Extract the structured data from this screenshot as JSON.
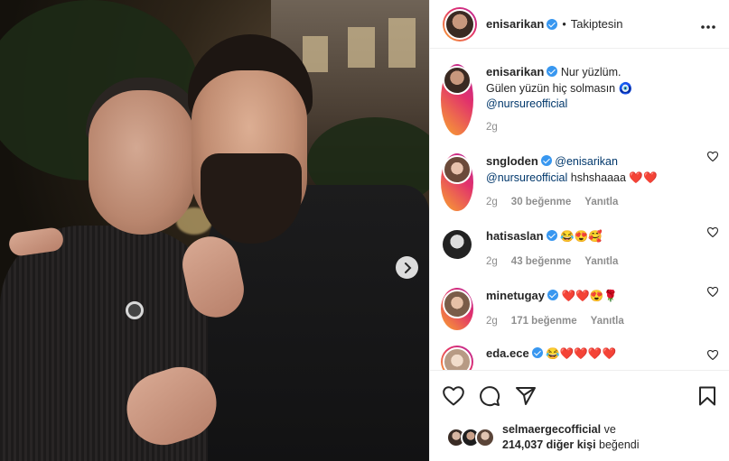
{
  "post": {
    "next_icon": "chevron-right-icon"
  },
  "header": {
    "username": "enisarikan",
    "separator": "•",
    "follow_status": "Takiptesin",
    "more_icon": "more-horizontal-icon"
  },
  "caption": {
    "username": "enisarikan",
    "text_line1": "Nur yüzlüm.",
    "text_line2": "Gülen yüzün hiç solmasın",
    "emoji": "🧿",
    "mention": "@nursureofficial",
    "time": "2g"
  },
  "comments": [
    {
      "username": "sngloden",
      "mention1": "@enisarikan",
      "mention2": "@nursureofficial",
      "text": "hshshaaaa",
      "emojis": "❤️❤️",
      "time": "2g",
      "likes": "30 beğenme",
      "reply": "Yanıtla"
    },
    {
      "username": "hatisaslan",
      "emojis": "😂😍🥰",
      "time": "2g",
      "likes": "43 beğenme",
      "reply": "Yanıtla"
    },
    {
      "username": "minetugay",
      "emojis": "❤️❤️😍🌹",
      "time": "2g",
      "likes": "171 beğenme",
      "reply": "Yanıtla"
    },
    {
      "username": "eda.ece",
      "emojis": "😂❤️❤️❤️❤️"
    }
  ],
  "likes_summary": {
    "top_liker": "selmaergecofficial",
    "connector": "ve",
    "others": "214,037 diğer kişi",
    "suffix": "beğendi"
  },
  "colors": {
    "verified": "#3897f0",
    "heart": "#ed4956",
    "mention": "#00376b",
    "meta": "#8e8e8e"
  }
}
